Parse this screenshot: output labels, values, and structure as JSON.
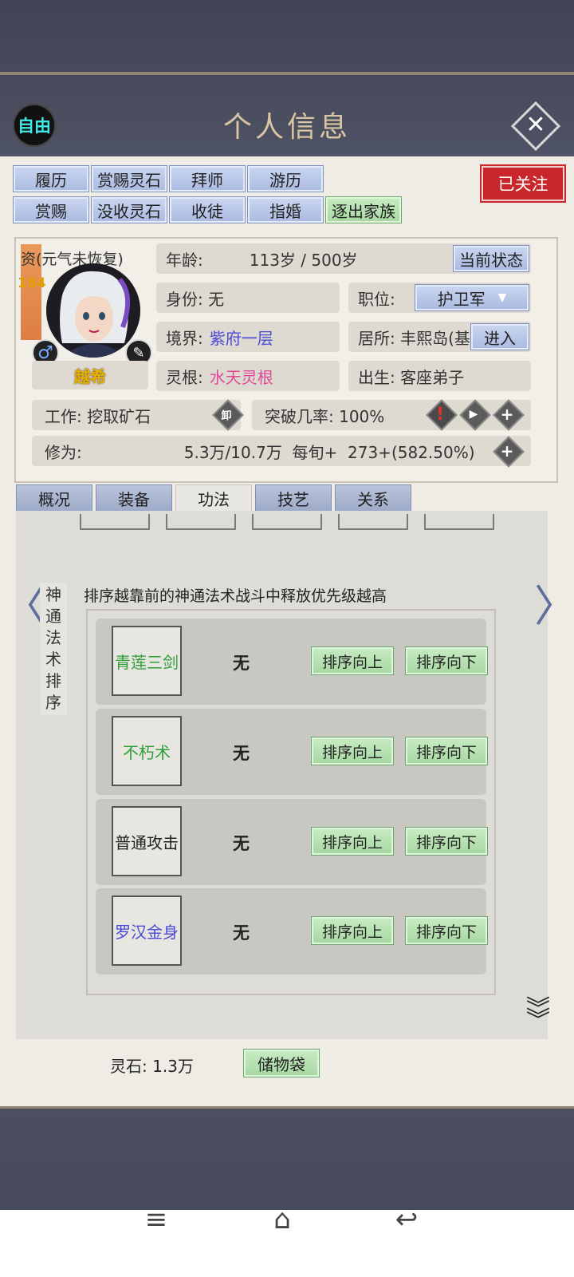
{
  "header": {
    "badge": "自由",
    "title": "个人信息"
  },
  "actions": {
    "row1": [
      "履历",
      "赏赐灵石",
      "拜师",
      "游历"
    ],
    "row2": [
      "赏赐",
      "没收灵石",
      "收徒",
      "指婚",
      "逐出家族"
    ],
    "followed": "已关注"
  },
  "profile": {
    "aptitude_label": "资(元气未恢复)",
    "aptitude_value": "184",
    "name": "越希",
    "age_label": "年龄:",
    "age_value": "113岁 / 500岁",
    "current_status_btn": "当前状态",
    "identity": "身份: 无",
    "position_label": "职位:",
    "position_value": "护卫军",
    "realm_label": "境界:",
    "realm_value": "紫府一层",
    "residence": "居所: 丰熙岛(基",
    "enter_btn": "进入",
    "root_label": "灵根:",
    "root_value": "水天灵根",
    "birth": "出生: 客座弟子",
    "job": "工作: 挖取矿石",
    "unequip": "卸",
    "breakthrough": "突破几率: 100%",
    "cultivation_label": "修为:",
    "cultivation_value": "5.3万/10.7万  每旬+  273+(582.50%)"
  },
  "tabs": [
    "概况",
    "装备",
    "功法",
    "技艺",
    "关系"
  ],
  "active_tab": "功法",
  "skills_panel": {
    "side_label": [
      "神",
      "通",
      "法",
      "术",
      "排",
      "序"
    ],
    "hint": "排序越靠前的神通法术战斗中释放优先级越高",
    "move_up": "排序向上",
    "move_down": "排序向下",
    "items": [
      {
        "name": "青莲三剑",
        "color": "#2f9e35",
        "slot": "无"
      },
      {
        "name": "不朽术",
        "color": "#2f9e35",
        "slot": "无"
      },
      {
        "name": "普通攻击",
        "color": "#222222",
        "slot": "无"
      },
      {
        "name": "罗汉金身",
        "color": "#4a4ad6",
        "slot": "无"
      }
    ]
  },
  "footer": {
    "spirit_stones": "灵石: 1.3万",
    "bag_btn": "储物袋"
  },
  "icons": [
    "close-icon",
    "male-icon",
    "pen-icon",
    "alert-icon",
    "play-icon",
    "plus-icon",
    "chevron-left-icon",
    "chevron-right-icon",
    "double-chevron-down-icon",
    "menu-icon",
    "home-icon",
    "back-icon"
  ]
}
